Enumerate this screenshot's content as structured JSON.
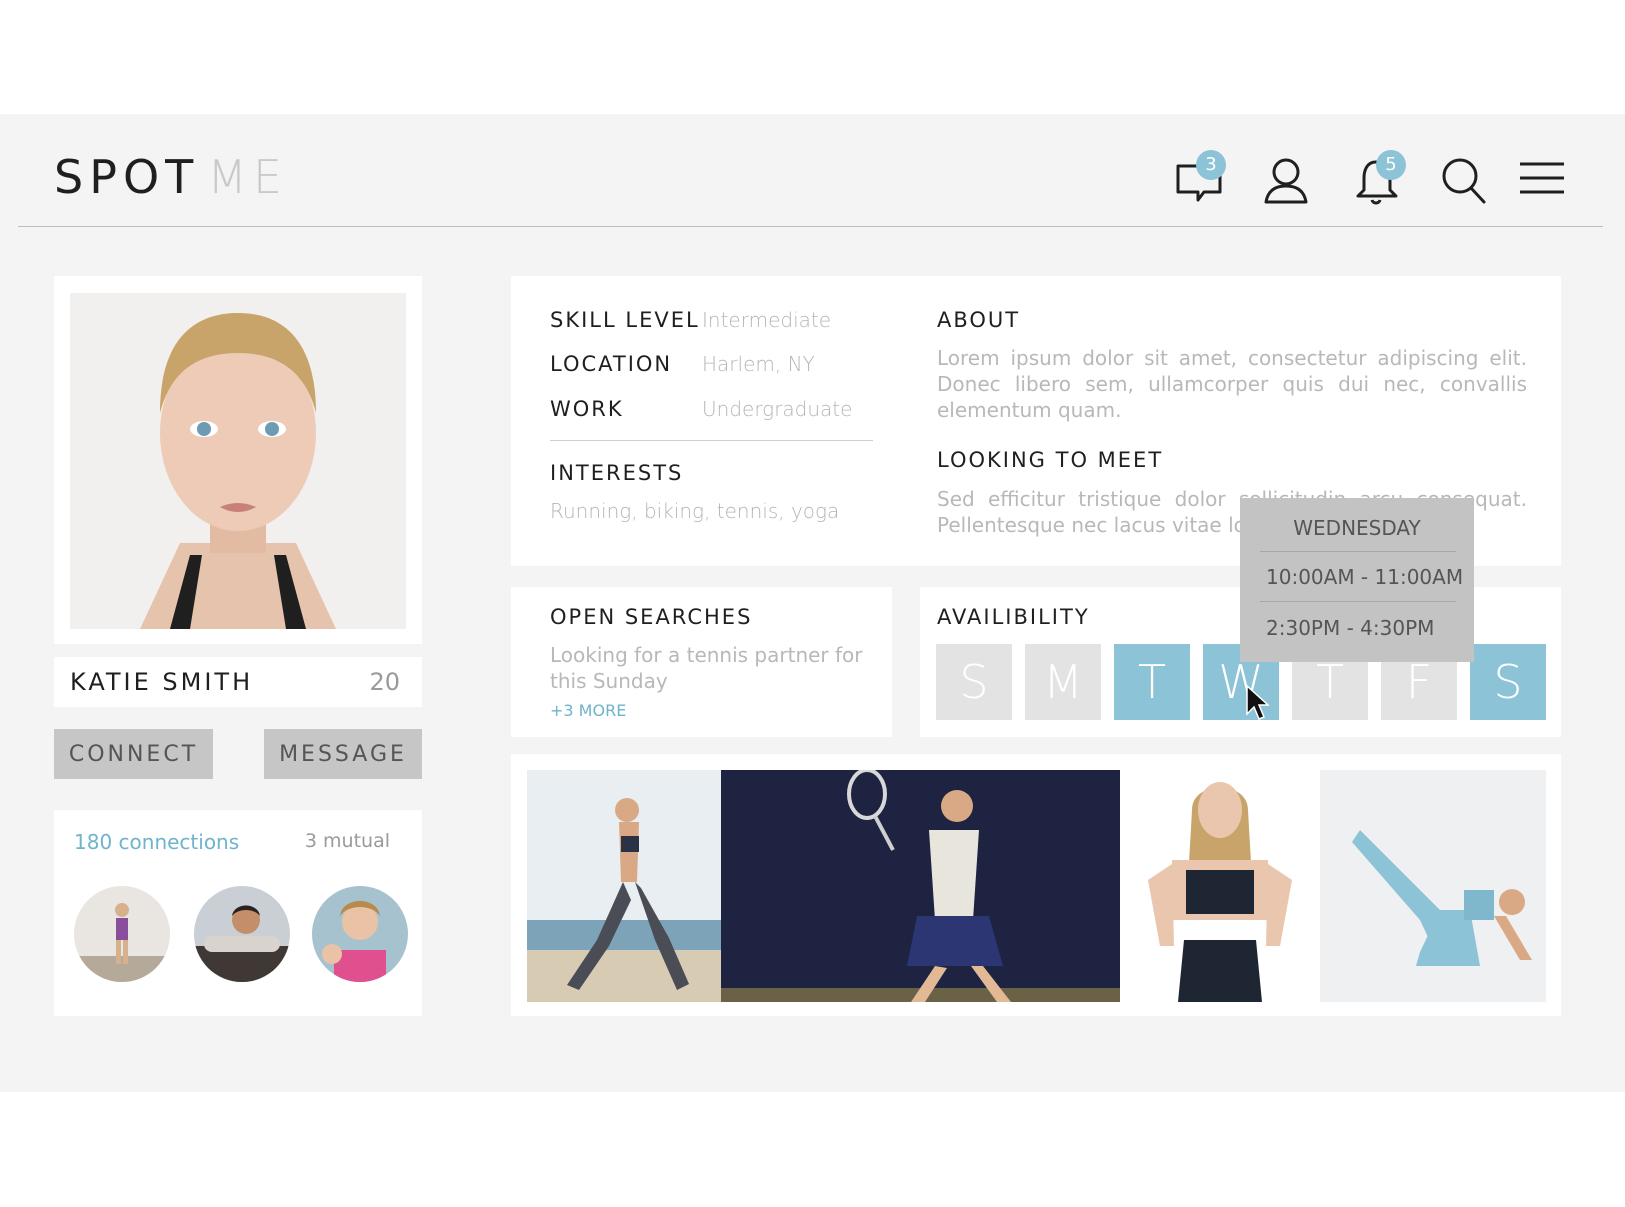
{
  "brand": {
    "part1": "SPOT",
    "part2": "ME"
  },
  "header": {
    "messages_badge": "3",
    "notifications_badge": "5",
    "icons": [
      "chat-icon",
      "user-icon",
      "bell-icon",
      "search-icon",
      "menu-icon"
    ]
  },
  "profile": {
    "name": "KATIE SMITH",
    "age": "20",
    "connect_label": "CONNECT",
    "message_label": "MESSAGE",
    "connections": "180 connections",
    "mutual": "3 mutual"
  },
  "details": {
    "skill_label": "SKILL LEVEL",
    "skill_value": "Intermediate",
    "location_label": "LOCATION",
    "location_value": "Harlem, NY",
    "work_label": "WORK",
    "work_value": "Undergraduate",
    "interests_label": "INTERESTS",
    "interests_value": "Running, biking, tennis, yoga",
    "about_label": "ABOUT",
    "about_text": "Lorem ipsum dolor sit amet, consectetur adipiscing elit. Donec libero sem, ullamcorper quis dui nec, convallis elementum quam.",
    "looking_label": "LOOKING TO MEET",
    "looking_text": "Sed efficitur tristique dolor sollicitudin arcu consequat. Pellentesque nec lacus vitae lorem tincidunt vel."
  },
  "searches": {
    "title": "OPEN SEARCHES",
    "text": "Looking for a tennis partner for this Sunday",
    "more": "+3 MORE"
  },
  "availability": {
    "title": "AVAILIBILITY",
    "days": [
      {
        "letter": "S",
        "available": false
      },
      {
        "letter": "M",
        "available": false
      },
      {
        "letter": "T",
        "available": true
      },
      {
        "letter": "W",
        "available": true
      },
      {
        "letter": "T",
        "available": false
      },
      {
        "letter": "F",
        "available": false
      },
      {
        "letter": "S",
        "available": true
      }
    ],
    "popup": {
      "day": "WEDNESDAY",
      "slots": [
        "10:00AM - 11:00AM",
        "2:30PM - 4:30PM"
      ]
    }
  },
  "colors": {
    "accent": "#8cc3d6",
    "background": "#f4f4f4",
    "inactive_day": "#e3e3e3",
    "button": "#c6c6c6"
  }
}
